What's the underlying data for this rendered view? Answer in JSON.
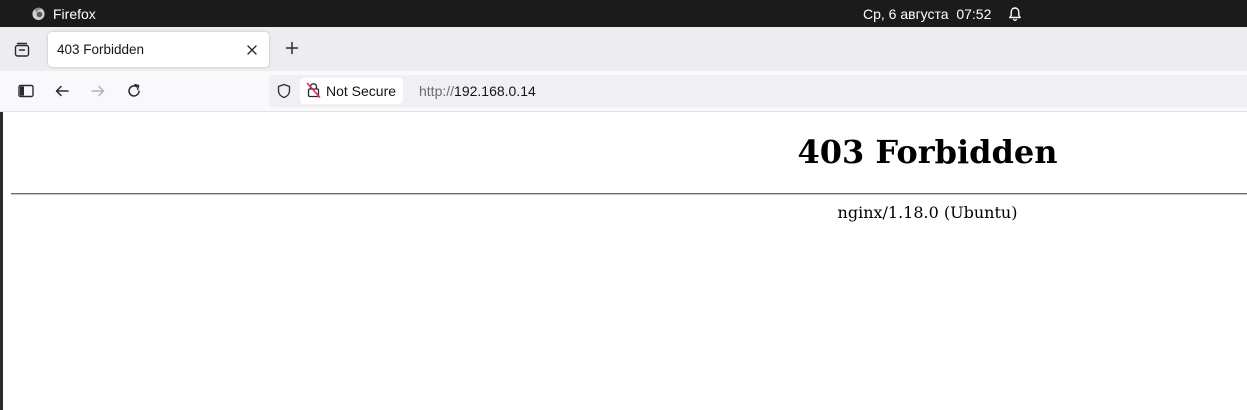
{
  "system_bar": {
    "app_name": "Firefox",
    "datetime": "Ср, 6 августа  07:52",
    "icons": [
      "firefox-icon",
      "bell-icon"
    ]
  },
  "browser": {
    "tabs": [
      {
        "label": "403 Forbidden",
        "active": true
      }
    ],
    "toolbar_icons": [
      "tab-overview-icon",
      "sidebar-icon",
      "back-icon",
      "forward-icon",
      "reload-icon",
      "close-icon",
      "new-tab-icon"
    ],
    "url_bar": {
      "security_label": "Not Secure",
      "url_scheme": "http://",
      "url_host": "192.168.0.14",
      "icons": [
        "shield-icon",
        "insecure-lock-icon"
      ]
    }
  },
  "page": {
    "heading": "403 Forbidden",
    "server_signature": "nginx/1.18.0 (Ubuntu)"
  },
  "colors": {
    "top_bar": "#1b1b1b",
    "tab_strip": "#ededf0",
    "nav_bar": "#f9f9fb",
    "url_field": "#f0f0f4",
    "insecure_lock_accent": "#e22850"
  }
}
